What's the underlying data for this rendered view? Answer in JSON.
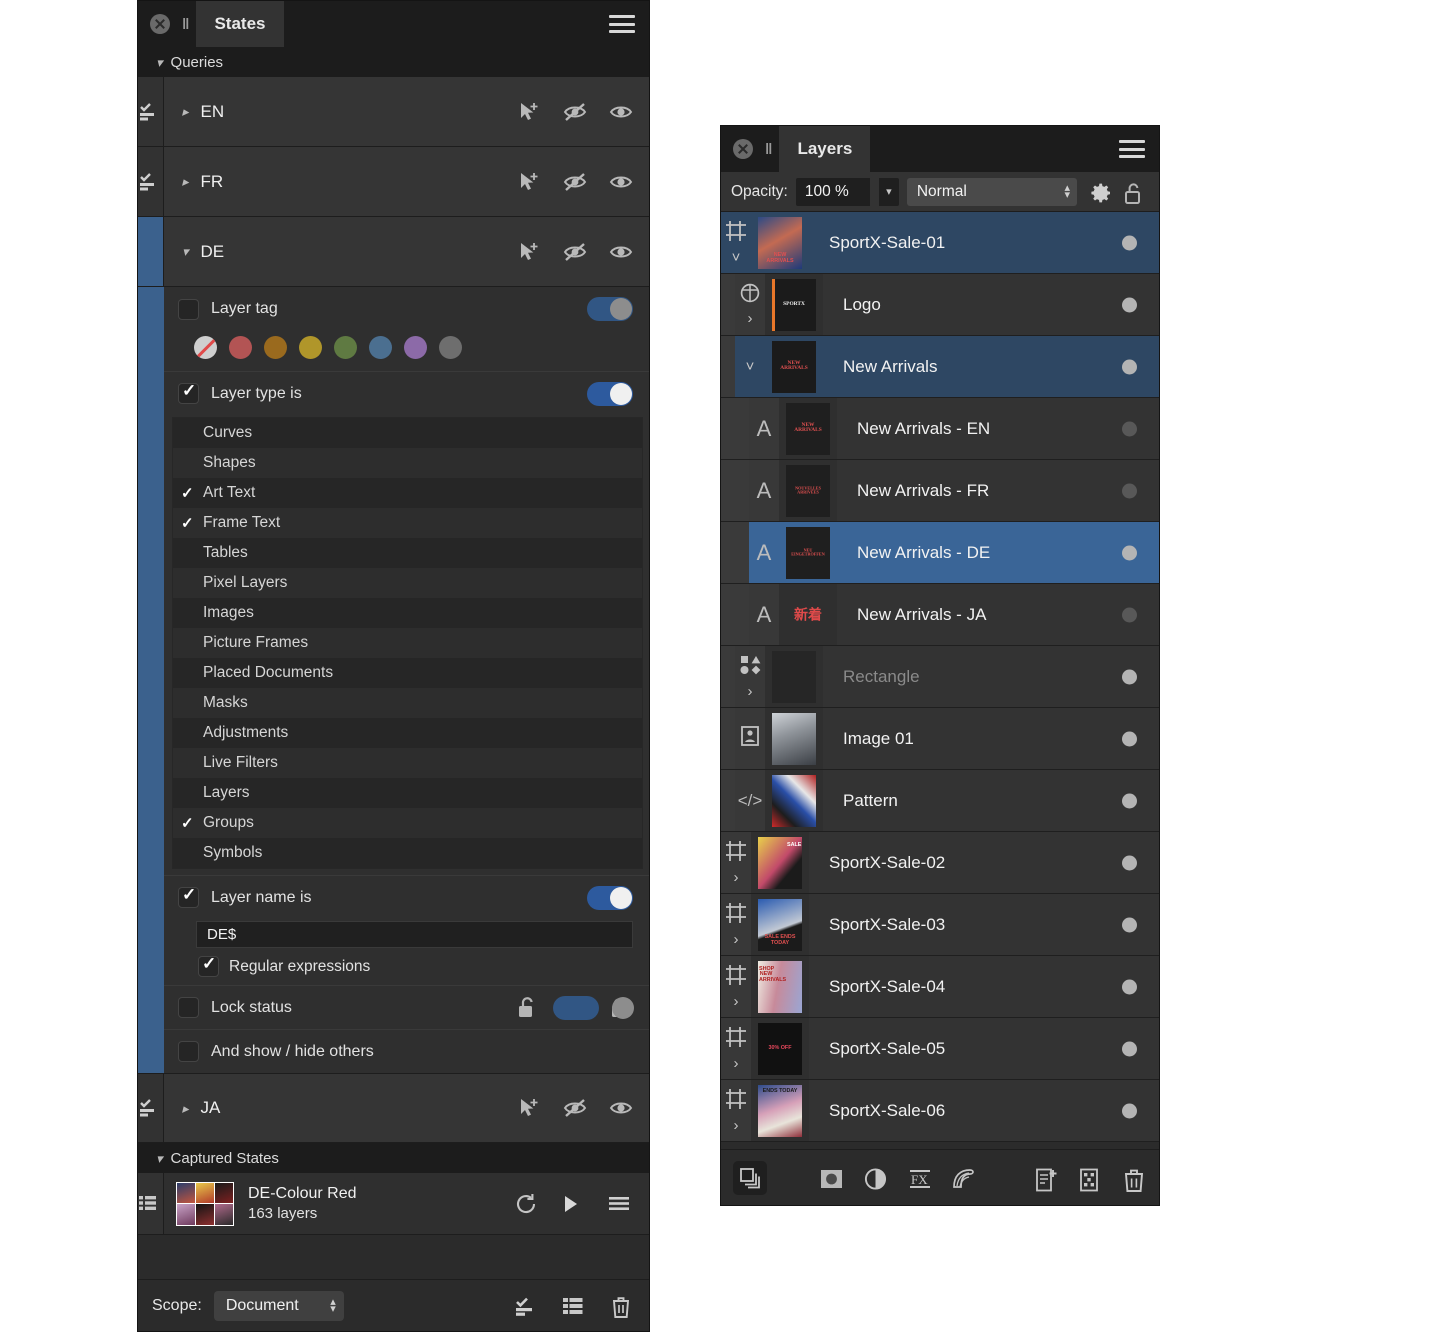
{
  "states_panel": {
    "title": "States",
    "groups": {
      "queries_label": "Queries",
      "captured_label": "Captured States"
    },
    "queries": [
      {
        "label": "EN",
        "expanded": false,
        "selected": false
      },
      {
        "label": "FR",
        "expanded": false,
        "selected": false
      },
      {
        "label": "DE",
        "expanded": true,
        "selected": true
      },
      {
        "label": "JA",
        "expanded": false,
        "selected": false
      }
    ],
    "query_row_icons": [
      "cursor-plus-icon",
      "eye-slash-icon",
      "eye-icon"
    ],
    "criteria": {
      "layer_tag": {
        "label": "Layer tag",
        "checked": false,
        "toggle_on": true,
        "toggle_dim": true
      },
      "layer_tag_swatches": [
        "none",
        "#b35454",
        "#9a6a1e",
        "#b0962a",
        "#5f7a42",
        "#4b6f90",
        "#8c6aa8",
        "#6e6e6e"
      ],
      "layer_type": {
        "label": "Layer type is",
        "checked": true,
        "toggle_on": true
      },
      "layer_type_items": [
        {
          "label": "Curves",
          "checked": false
        },
        {
          "label": "Shapes",
          "checked": false
        },
        {
          "label": "Art Text",
          "checked": true
        },
        {
          "label": "Frame Text",
          "checked": true
        },
        {
          "label": "Tables",
          "checked": false
        },
        {
          "label": "Pixel Layers",
          "checked": false
        },
        {
          "label": "Images",
          "checked": false
        },
        {
          "label": "Picture Frames",
          "checked": false
        },
        {
          "label": "Placed Documents",
          "checked": false
        },
        {
          "label": "Masks",
          "checked": false
        },
        {
          "label": "Adjustments",
          "checked": false
        },
        {
          "label": "Live Filters",
          "checked": false
        },
        {
          "label": "Layers",
          "checked": false
        },
        {
          "label": "Groups",
          "checked": true
        },
        {
          "label": "Symbols",
          "checked": false
        }
      ],
      "layer_name": {
        "label": "Layer name is",
        "checked": true,
        "toggle_on": true,
        "value": "DE$"
      },
      "regex": {
        "label": "Regular expressions",
        "checked": true
      },
      "lock_status": {
        "label": "Lock status",
        "checked": false,
        "toggle_dim": true,
        "left_icon": "unlock-icon",
        "right_icon": "lock-icon"
      },
      "show_hide_others": {
        "label": "And show / hide others",
        "checked": false
      }
    },
    "captured_states": [
      {
        "title": "DE-Colour Red",
        "subtitle": "163 layers",
        "icons": [
          "restore-icon",
          "play-icon",
          "menu-icon"
        ]
      }
    ],
    "scope": {
      "label": "Scope:",
      "value": "Document",
      "icons": [
        "apply-query-icon",
        "list-icon",
        "trash-icon"
      ]
    }
  },
  "layers_panel": {
    "title": "Layers",
    "opacity": {
      "label": "Opacity:",
      "value": "100 %"
    },
    "blend_mode": "Normal",
    "header_icons": [
      "gear-icon",
      "unlock-icon"
    ],
    "rows": [
      {
        "name": "SportX-Sale-01",
        "indent": 0,
        "mark": "artboard-icon",
        "expander": "down",
        "select": "dark",
        "thumb": "model-newarrivals",
        "dim": false
      },
      {
        "name": "Logo",
        "indent": 1,
        "mark": "symbol-icon",
        "expander": "right",
        "select": "none",
        "thumb": "sportx-logo",
        "dim": false
      },
      {
        "name": "New Arrivals",
        "indent": 1,
        "mark": "",
        "expander": "down",
        "select": "dark",
        "thumb": "new-arrivals",
        "dim": false
      },
      {
        "name": "New Arrivals - EN",
        "indent": 2,
        "mark": "text-icon",
        "expander": "none",
        "select": "none",
        "thumb": "new-arrivals-en",
        "dim": false
      },
      {
        "name": "New Arrivals - FR",
        "indent": 2,
        "mark": "text-icon",
        "expander": "none",
        "select": "none",
        "thumb": "new-arrivals-fr",
        "dim": false
      },
      {
        "name": "New Arrivals - DE",
        "indent": 2,
        "mark": "text-icon",
        "expander": "none",
        "select": "bright",
        "thumb": "new-arrivals-de",
        "dim": false
      },
      {
        "name": "New Arrivals - JA",
        "indent": 2,
        "mark": "text-icon",
        "expander": "none",
        "select": "none",
        "thumb": "new-arrivals-ja",
        "dim": false
      },
      {
        "name": "Rectangle",
        "indent": 1,
        "mark": "shapes-icon",
        "expander": "right",
        "select": "none",
        "thumb": "empty-dark",
        "dim": true
      },
      {
        "name": "Image 01",
        "indent": 1,
        "mark": "image-icon",
        "expander": "none",
        "select": "none",
        "thumb": "photo-model",
        "dim": false
      },
      {
        "name": "Pattern",
        "indent": 1,
        "mark": "code-icon",
        "expander": "none",
        "select": "none",
        "thumb": "pattern-collage",
        "dim": false
      },
      {
        "name": "SportX-Sale-02",
        "indent": 0,
        "mark": "artboard-icon",
        "expander": "right",
        "select": "none",
        "thumb": "sale-02",
        "dim": false
      },
      {
        "name": "SportX-Sale-03",
        "indent": 0,
        "mark": "artboard-icon",
        "expander": "right",
        "select": "none",
        "thumb": "sale-03",
        "dim": false
      },
      {
        "name": "SportX-Sale-04",
        "indent": 0,
        "mark": "artboard-icon",
        "expander": "right",
        "select": "none",
        "thumb": "sale-04",
        "dim": false
      },
      {
        "name": "SportX-Sale-05",
        "indent": 0,
        "mark": "artboard-icon",
        "expander": "right",
        "select": "none",
        "thumb": "sale-05",
        "dim": false
      },
      {
        "name": "SportX-Sale-06",
        "indent": 0,
        "mark": "artboard-icon",
        "expander": "right",
        "select": "none",
        "thumb": "sale-06",
        "dim": false
      }
    ],
    "thumb_text": {
      "sportx-logo": "SPORTX",
      "new-arrivals": "NEW ARRIVALS",
      "new-arrivals-en": "NEW ARRIVALS",
      "new-arrivals-fr": "NOUVELLES ARRIVÉES",
      "new-arrivals-de": "NEU EINGETROFFEN",
      "new-arrivals-ja": "新着"
    },
    "footer_icons": [
      "layers-stack-icon",
      "mask-icon",
      "adjustment-icon",
      "fx-icon",
      "live-filter-icon",
      "new-layer-icon",
      "new-pixel-layer-icon",
      "trash-icon"
    ]
  },
  "colors": {
    "accent_blue": "#3b618d",
    "toggle_blue": "#2d5a9e",
    "selected_bright": "#3a6597",
    "selected_dark": "#2e4763",
    "panel_bg": "#2b2b2b",
    "titlebar_bg": "#1c1c1c"
  }
}
